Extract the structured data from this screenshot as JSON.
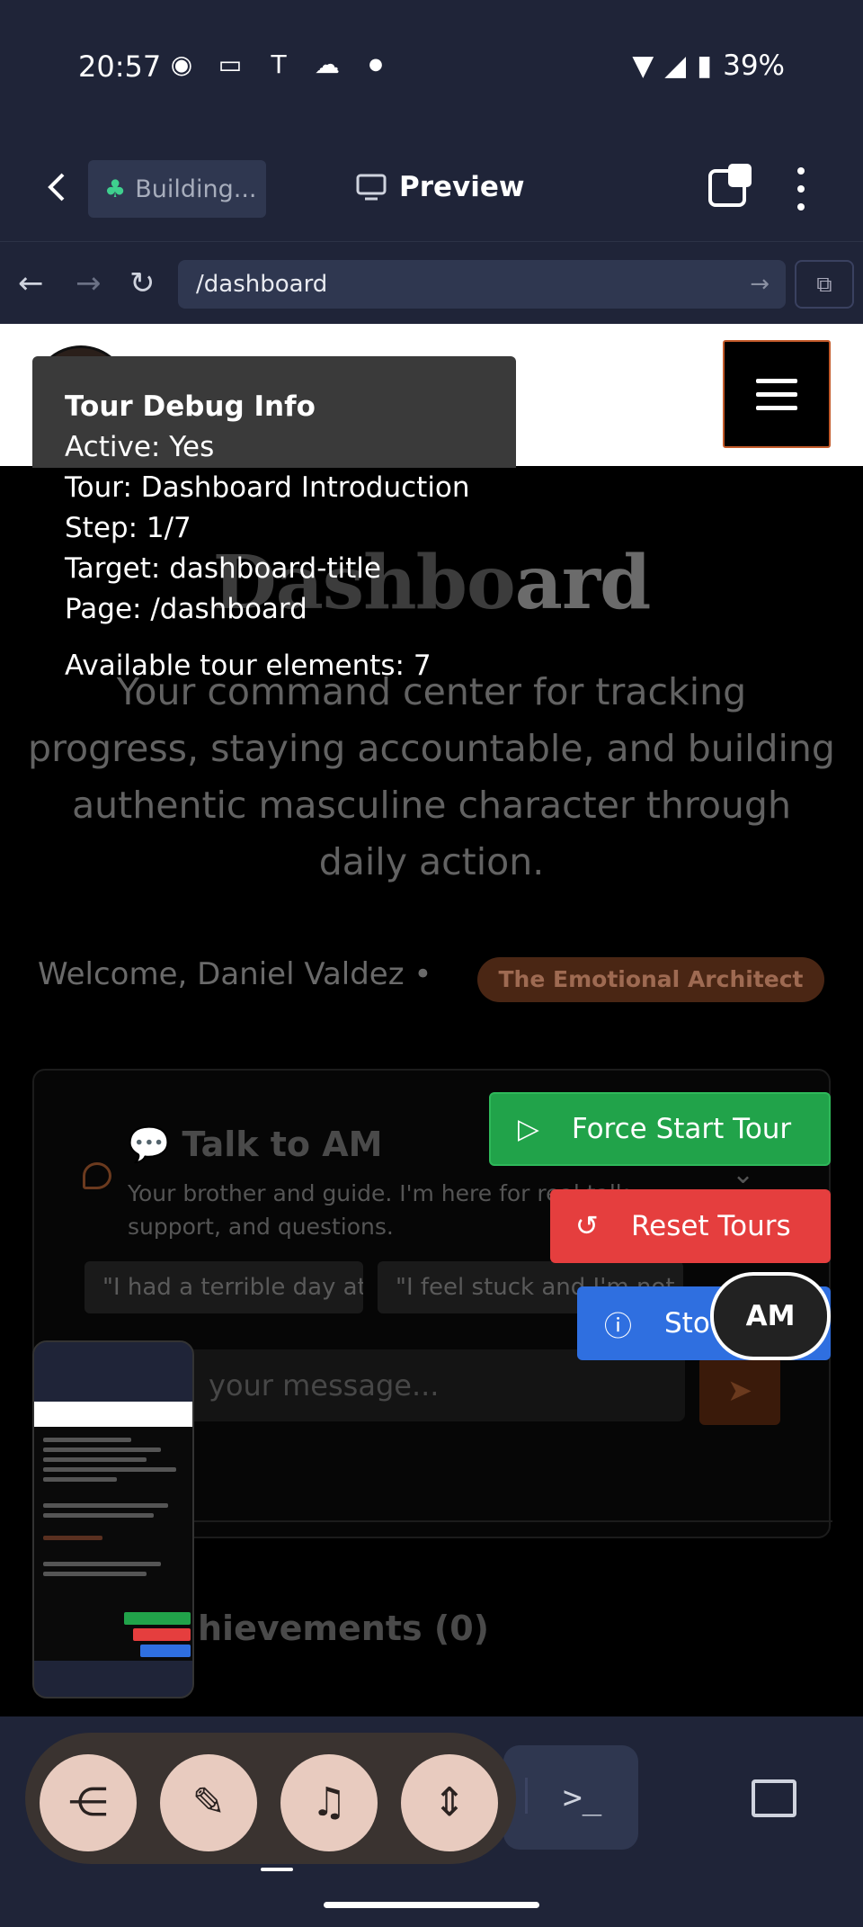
{
  "status_bar": {
    "time": "20:57",
    "battery": "39%",
    "icons": [
      "app-icon",
      "cast-icon",
      "tesla-icon",
      "cloud-icon",
      "dot-icon"
    ]
  },
  "browser": {
    "building_label": "Building...",
    "preview_label": "Preview",
    "url": "/dashboard"
  },
  "tour_debug": {
    "title": "Tour Debug Info",
    "active": "Active: Yes",
    "tour": "Tour: Dashboard Introduction",
    "step": "Step: 1/7",
    "target": "Target: dashboard-title",
    "page": "Page: /dashboard",
    "available": "Available tour elements: 7"
  },
  "dashboard": {
    "title_dim": "Dashbo",
    "title_lit": "ard",
    "subtitle": "Your command center for tracking progress, staying accountable, and building authentic masculine character through daily action.",
    "welcome": "Welcome, Daniel Valdez •",
    "badge": "The Emotional Architect"
  },
  "talk": {
    "title": "💬 Talk to AM",
    "subtitle": "Your brother and guide. I'm here for real talk, support, and questions.",
    "chips": [
      "\"I had a terrible day at work.\"",
      "\"I feel stuck and I'm not"
    ],
    "input_placeholder": "your message..."
  },
  "achievements": {
    "title": "hievements (0)"
  },
  "tour_buttons": {
    "force_start": "Force Start Tour",
    "reset": "Reset Tours",
    "stop": "Sto"
  },
  "am_button": "AM",
  "colors": {
    "green": "#21a34a",
    "red": "#e53e3e",
    "blue": "#2f6fe0",
    "badge_bg": "#4a2614"
  }
}
